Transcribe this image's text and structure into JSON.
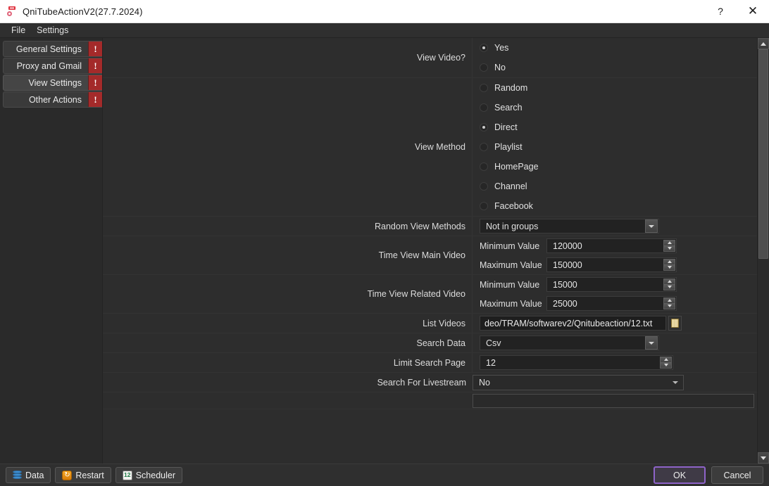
{
  "window": {
    "title": "QniTubeActionV2(27.7.2024)",
    "app_icon": "app-icon",
    "help_glyph": "?",
    "close_glyph": "✕"
  },
  "menubar": {
    "items": [
      {
        "label": "File"
      },
      {
        "label": "Settings"
      }
    ]
  },
  "sidebar": {
    "tabs": [
      {
        "label": "General Settings",
        "badge": "!",
        "active": false
      },
      {
        "label": "Proxy and Gmail",
        "badge": "!",
        "active": false
      },
      {
        "label": "View Settings",
        "badge": "!",
        "active": true
      },
      {
        "label": "Other Actions",
        "badge": "!",
        "active": false
      }
    ]
  },
  "form": {
    "view_video": {
      "label": "View Video?",
      "options": [
        {
          "label": "Yes",
          "selected": true
        },
        {
          "label": "No",
          "selected": false
        }
      ]
    },
    "view_method": {
      "label": "View Method",
      "options": [
        {
          "label": "Random",
          "selected": false
        },
        {
          "label": "Search",
          "selected": false
        },
        {
          "label": "Direct",
          "selected": true
        },
        {
          "label": "Playlist",
          "selected": false
        },
        {
          "label": "HomePage",
          "selected": false
        },
        {
          "label": "Channel",
          "selected": false
        },
        {
          "label": "Facebook",
          "selected": false
        }
      ]
    },
    "random_view_methods": {
      "label": "Random View Methods",
      "value": "Not in groups"
    },
    "time_view_main_video": {
      "label": "Time View Main Video",
      "min_caption": "Minimum Value",
      "min_value": "120000",
      "max_caption": "Maximum Value",
      "max_value": "150000"
    },
    "time_view_related_video": {
      "label": "Time View Related Video",
      "min_caption": "Minimum Value",
      "min_value": "15000",
      "max_caption": "Maximum Value",
      "max_value": "25000"
    },
    "list_videos": {
      "label": "List Videos",
      "value": "deo/TRAM/softwarev2/Qnitubeaction/12.txt",
      "browse_icon": "folder-icon"
    },
    "search_data": {
      "label": "Search Data",
      "value": "Csv"
    },
    "limit_search_page": {
      "label": "Limit Search Page",
      "value": "12"
    },
    "search_for_livestream": {
      "label": "Search For Livestream",
      "value": "No"
    }
  },
  "bottombar": {
    "buttons": [
      {
        "label": "Data",
        "icon": "database-icon"
      },
      {
        "label": "Restart",
        "icon": "restart-icon"
      },
      {
        "label": "Scheduler",
        "icon": "calendar-icon"
      }
    ],
    "ok_label": "OK",
    "cancel_label": "Cancel"
  },
  "colors": {
    "accent_focus": "#8e63c9",
    "badge_red": "#a42a2a",
    "window_bg": "#2d2d2d",
    "field_bg": "#222222"
  }
}
